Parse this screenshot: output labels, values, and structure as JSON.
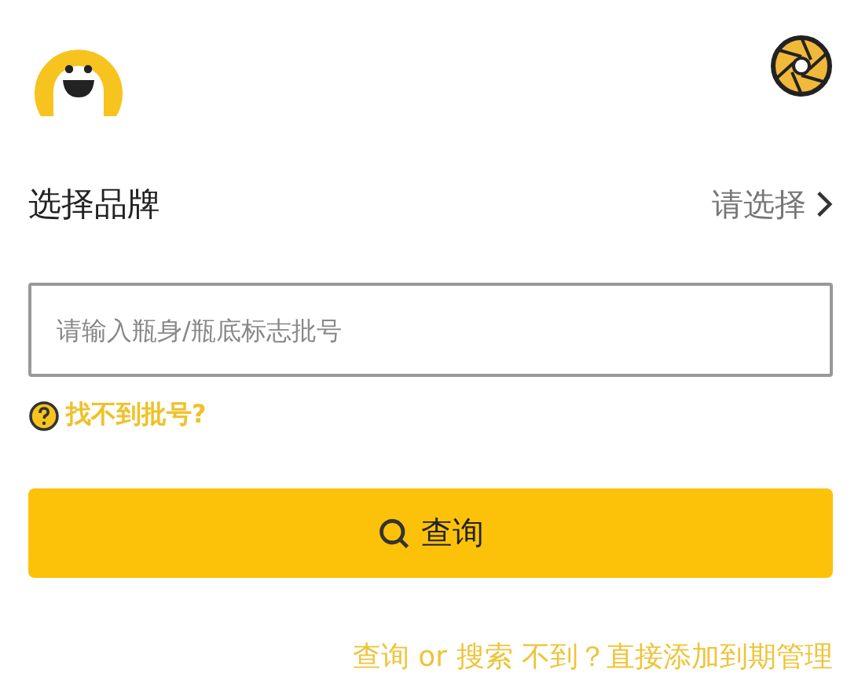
{
  "brand_row": {
    "label": "选择品牌",
    "value": "请选择"
  },
  "batch_field": {
    "placeholder": "请输入瓶身/瓶底标志批号"
  },
  "help_link": "找不到批号?",
  "query_button": "查询",
  "footer_link": "查询 or 搜索 不到？直接添加到期管理"
}
